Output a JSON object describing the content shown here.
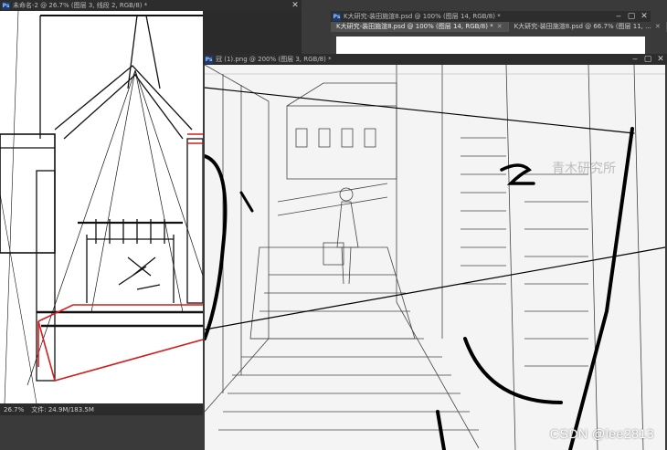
{
  "left_window": {
    "title": "未命名-2 @ 26.7% (图层 3, 线段 2, RGB/8) *",
    "status_zoom": "26.7%",
    "status_doc": "文件: 24.9M/183.5M",
    "close_label": "✕"
  },
  "right_window": {
    "title": "K大研究-装田施渲8.psd @ 100% (图层 14, RGB/8) *",
    "tabs": [
      {
        "label": "K大研究-装田施渲8.psd @ 100% (图层 14, RGB/8) *",
        "close": "✕"
      },
      {
        "label": "K大研究-装田施渲8.psd @ 66.7% (图层 11, ...",
        "close": "✕"
      }
    ],
    "min_label": "‒",
    "max_label": "▢",
    "close_label": "✕"
  },
  "front_window": {
    "title": "冠 (1).png @ 200% (图层 3, RGB/8) *",
    "min_label": "‒",
    "max_label": "▢",
    "close_label": "✕",
    "sketch_numeral": "2",
    "ghost_text": "青木研究所"
  },
  "watermark": "CSDN @lee2813",
  "colors": {
    "app_bg": "#3a3a3a",
    "titlebar": "#2d2d2d",
    "sketch_red": "#d21e1e"
  },
  "icons": [
    "photoshop-icon",
    "minimize-icon",
    "maximize-icon",
    "close-icon"
  ]
}
